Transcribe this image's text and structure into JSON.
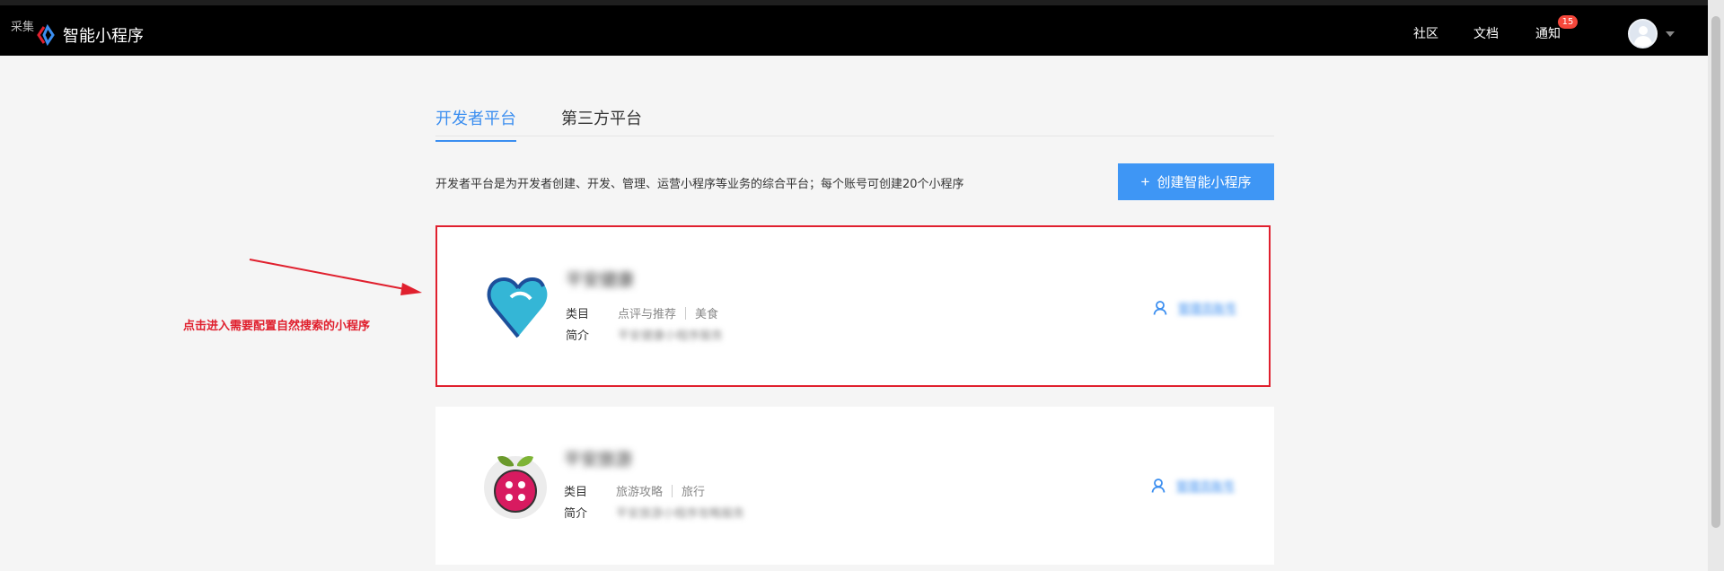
{
  "collect_tag": "采集",
  "app": {
    "title": "智能小程序"
  },
  "nav": {
    "items": [
      {
        "label": "社区"
      },
      {
        "label": "文档"
      },
      {
        "label": "通知",
        "badge": "15"
      }
    ]
  },
  "tabs": [
    {
      "label": "开发者平台",
      "active": true
    },
    {
      "label": "第三方平台",
      "active": false
    }
  ],
  "description": "开发者平台是为开发者创建、开发、管理、运营小程序等业务的综合平台；每个账号可创建20个小程序",
  "create_button": {
    "plus": "+",
    "label": "创建智能小程序"
  },
  "cards": [
    {
      "name": "平安健康",
      "category_label": "类目",
      "category": [
        "点评与推荐",
        "美食"
      ],
      "intro_label": "简介",
      "intro": "平安健康小程序服务",
      "owner": "管理员账号",
      "icon": "heart-logo-icon"
    },
    {
      "name": "平安旅游",
      "category_label": "类目",
      "category": [
        "旅游攻略",
        "旅行"
      ],
      "intro_label": "简介",
      "intro": "平安旅游小程序攻略服务",
      "owner": "管理员账号",
      "icon": "strawberry-logo-icon"
    }
  ],
  "annotation": "点击进入需要配置自然搜索的小程序",
  "colors": {
    "accent": "#3b8ef0",
    "button": "#3e96f5",
    "highlight": "#e0202e",
    "badge": "#f5473b"
  }
}
